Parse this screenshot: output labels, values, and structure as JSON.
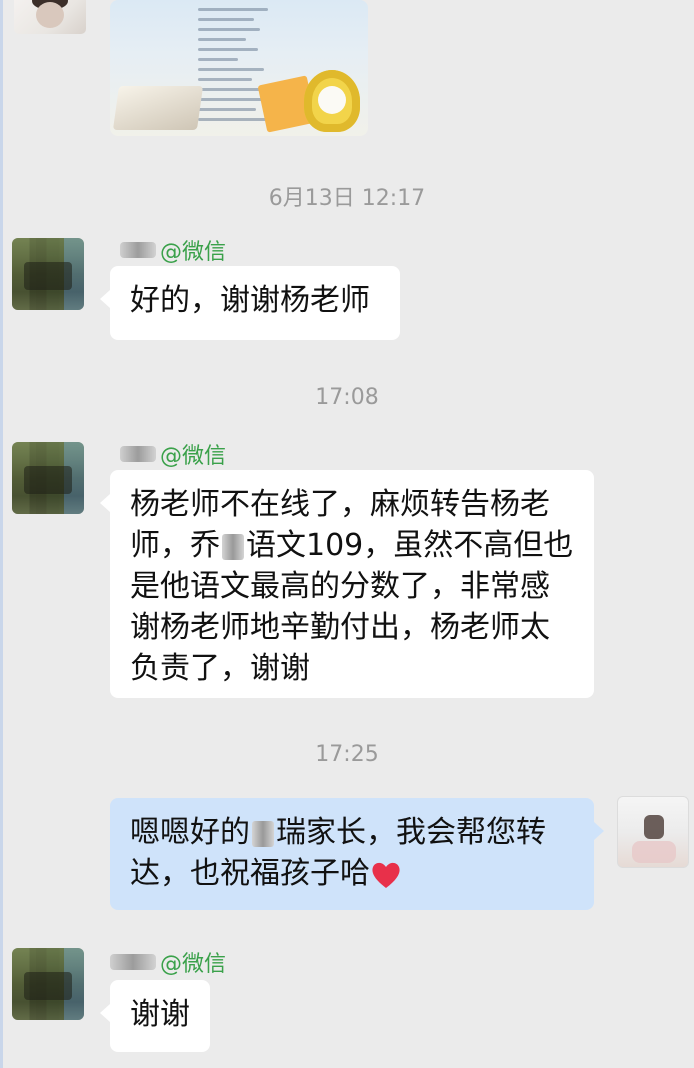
{
  "chat": {
    "timestamps": [
      "6月13日 12:17",
      "17:08",
      "17:25"
    ],
    "messages": [
      {
        "sender_suffix": "@微信",
        "text": "好的，谢谢杨老师"
      },
      {
        "sender_suffix": "@微信",
        "text_part1": "杨老师不在线了，麻烦转告杨老师，乔",
        "text_part2": "语文109，虽然不高但也是他语文最高的分数了，非常感谢杨老师地辛勤付出，杨老师太负责了，谢谢"
      },
      {
        "text_part1": "嗯嗯好的",
        "text_part2": "瑞家长，我会帮您转达，也祝福孩子哈"
      },
      {
        "sender_suffix": "@微信",
        "text": "谢谢"
      }
    ]
  },
  "colors": {
    "background": "#ebebeb",
    "incoming_bubble": "#ffffff",
    "outgoing_bubble": "#cfe3fa",
    "wechat_tag_green": "#3aa14a",
    "timestamp_gray": "#9a9a9a",
    "heart_red": "#e8304a"
  },
  "icons": {
    "heart": "red-heart-emoji"
  }
}
